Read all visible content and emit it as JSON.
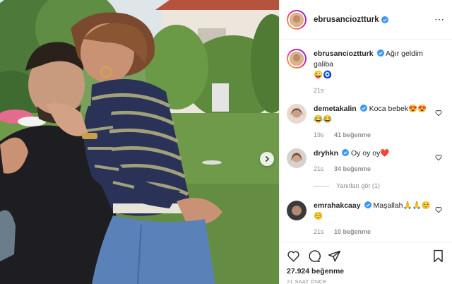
{
  "post": {
    "username": "ebrusancioztturk",
    "caption_user": "ebrusancioztturk",
    "caption_text": "Ağır geldim galiba",
    "caption_emoji": "😜🧿",
    "caption_time": "21s",
    "likes_total": "27.924 beğenme",
    "time_ago": "21 SAAT ÖNCE",
    "more_icon": "⋯"
  },
  "comments": [
    {
      "user": "demetakalin",
      "text": "Koca bebek😍😍",
      "text2": "😂😂",
      "time": "19s",
      "likes": "41 beğenme"
    },
    {
      "user": "dryhkn",
      "text": "Oy oy oy❤️",
      "text2": "",
      "time": "21s",
      "likes": "34 beğenme"
    },
    {
      "user": "emrahakcaay",
      "text": "Maşallah🙏🙏☺️",
      "text2": "☺️",
      "time": "21s",
      "likes": "10 beğenme"
    }
  ],
  "replies": {
    "label": "Yanıtları gör (1)"
  },
  "colors": {
    "verified": "#3897f0",
    "muted": "#8e8e8e",
    "border": "#efefef"
  },
  "icons": [
    "heart-icon",
    "comment-icon",
    "share-icon",
    "bookmark-icon",
    "chevron-right-icon",
    "verified-badge-icon"
  ]
}
